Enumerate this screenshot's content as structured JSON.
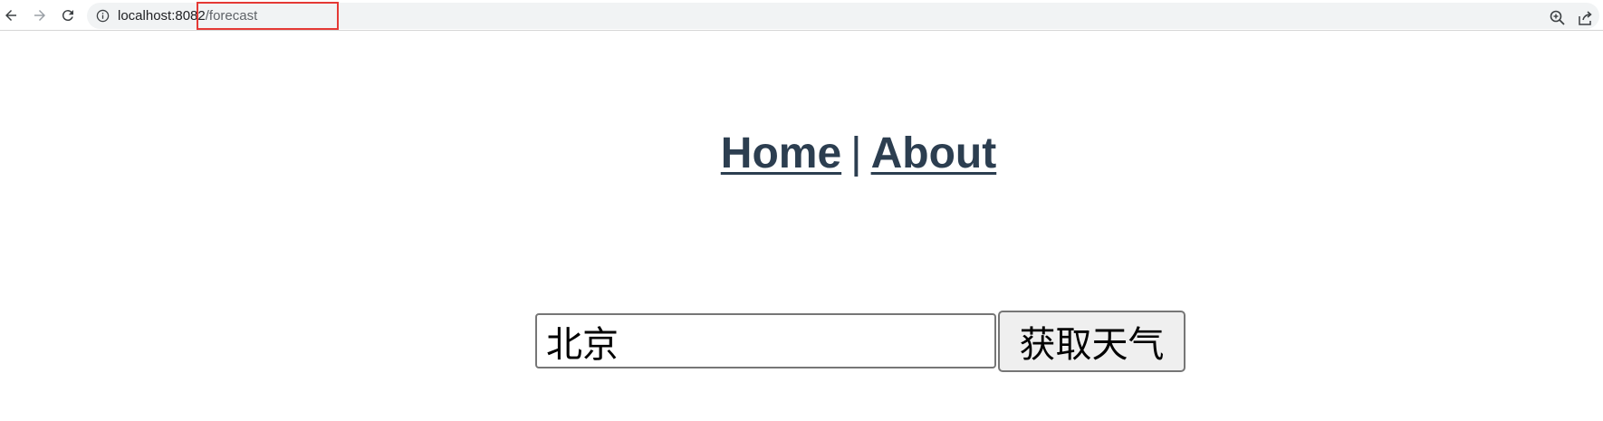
{
  "browser": {
    "url_host": "localhost:8082",
    "url_path": "/forecast",
    "icons": [
      "back-arrow-icon",
      "forward-arrow-icon",
      "reload-icon",
      "info-icon",
      "zoom-icon",
      "share-icon"
    ]
  },
  "nav": {
    "home_label": "Home",
    "separator": "|",
    "about_label": "About"
  },
  "form": {
    "city_value": "北京",
    "submit_label": "获取天气"
  },
  "colors": {
    "nav_text": "#2c3e50",
    "highlight": "#e53935"
  }
}
